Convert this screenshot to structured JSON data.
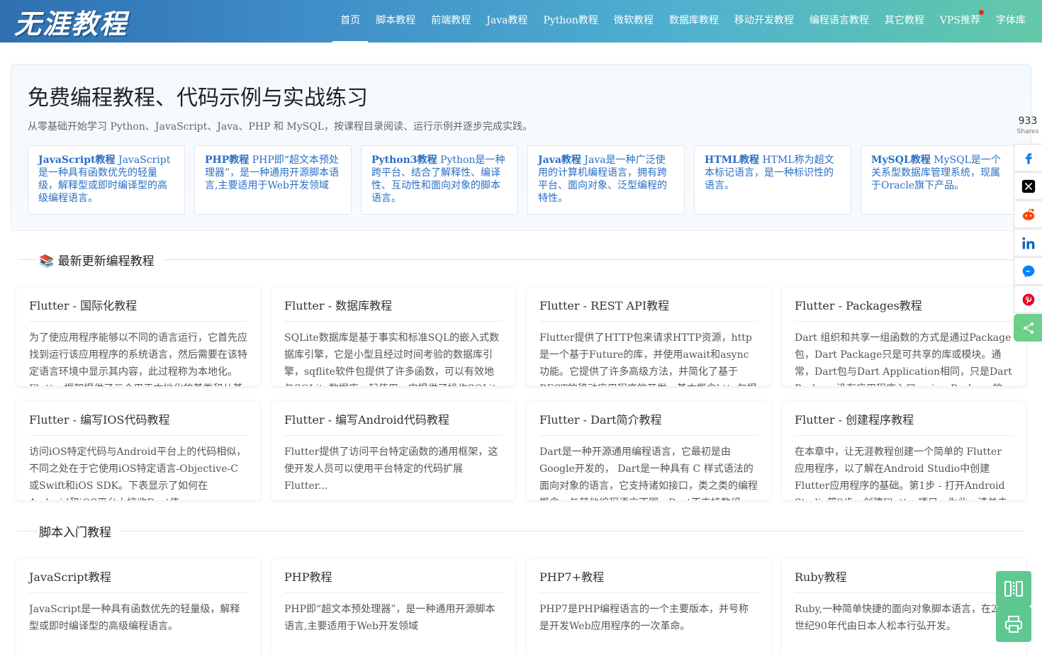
{
  "header": {
    "logo_text": "无涯教程",
    "nav": [
      {
        "label": "首页",
        "active": true
      },
      {
        "label": "脚本教程"
      },
      {
        "label": "前端教程"
      },
      {
        "label": "Java教程"
      },
      {
        "label": "Python教程"
      },
      {
        "label": "微软教程"
      },
      {
        "label": "数据库教程"
      },
      {
        "label": "移动开发教程"
      },
      {
        "label": "编程语言教程"
      },
      {
        "label": "其它教程"
      },
      {
        "label": "VPS推荐",
        "badge_dot": true
      },
      {
        "label": "字体库"
      }
    ]
  },
  "hero": {
    "title": "免费编程教程、代码示例与实战练习",
    "subtitle": "从零基础开始学习 Python、JavaScript、Java、PHP 和 MySQL，按课程目录阅读、运行示例并逐步完成实践。",
    "features": [
      {
        "name": "JavaScript教程",
        "desc": "JavaScript是一种具有函数优先的轻量级，解释型或即时编译型的高级编程语言。"
      },
      {
        "name": "PHP教程",
        "desc": "PHP即“超文本预处理器”，是一种通用开源脚本语言,主要适用于Web开发领域"
      },
      {
        "name": "Python3教程",
        "desc": "Python是一种跨平台、结合了解释性、编译性、互动性和面向对象的脚本语言。"
      },
      {
        "name": "Java教程",
        "desc": "Java是一种广泛使用的计算机编程语言，拥有跨平台、面向对象、泛型编程的特性。"
      },
      {
        "name": "HTML教程",
        "desc": "HTML称为超文本标记语言，是一种标识性的语言。"
      },
      {
        "name": "MySQL教程",
        "desc": "MySQL是一个关系型数据库管理系统，现属于Oracle旗下产品。"
      }
    ]
  },
  "sections": [
    {
      "icon": "📚",
      "title": "最新更新编程教程",
      "cards": [
        {
          "title": "Flutter - 国际化教程",
          "body": "为了使应用程序能够以不同的语言运行，它首先应找到运行该应用程序的系统语言，然后需要在该特定语言环境中显示其内容，此过程称为本地化。Flutter框架提供了三个用于本地化的基类和从基类"
        },
        {
          "title": "Flutter - 数据库教程",
          "body": "SQLite数据库是基于事实和标准SQL的嵌入式数据库引擎，它是小型且经过时间考验的数据库引擎，sqflite软件包提供了许多函数，可以有效地与SQLite数据库一起使用，它提供了操作SQLite数据"
        },
        {
          "title": "Flutter - REST API教程",
          "body": "Flutter提供了HTTP包来请求HTTP资源，http是一个基于Future的库，并使用await和async功能。它提供了许多高级方法，并简化了基于REST的移动应用程序的开发。基本概念http包提供了一个高级"
        },
        {
          "title": "Flutter - Packages教程",
          "body": "Dart 组织和共享一组函数的方式是通过Package包，Dart Package只是可共享的库或模块。通常，Dart包与Dart Application相同，只是Dart Package没有应用程序入口main。Package的一般结构(考虑一"
        },
        {
          "title": "Flutter - 编写IOS代码教程",
          "body": "访问iOS特定代码与Android平台上的代码相似，不同之处在于它使用iOS特定语言-Objective-C或Swift和iOS SDK。下表显示了如何在Android和iOS平台上接收Dart值。dartandroidiosnullnull无(嵌套时为"
        },
        {
          "title": "Flutter - 编写Android代码教程",
          "body": "Flutter提供了访问平台特定函数的通用框架，这使开发人员可以使用平台特定的代码扩展 Flutter..."
        },
        {
          "title": "Flutter - Dart简介教程",
          "body": "Dart是一种开源通用编程语言，它最初是由Google开发的， Dart是一种具有 C 样式语法的面向对象的语言，它支持诸如接口，类之类的编程概念，与其他编程语言不同，Dart不支持数组， Dart集合可"
        },
        {
          "title": "Flutter - 创建程序教程",
          "body": "在本章中，让无涯教程创建一个简单的 Flutter 应用程序，以了解在Android Studio中创建Flutter应用程序的基础。第1步 - 打开Android Studio第2步 - 创建Flutter项目。为此，请单击File→New→New"
        }
      ]
    },
    {
      "icon": "",
      "title": "脚本入门教程",
      "cards": [
        {
          "title": "JavaScript教程",
          "body": "JavaScript是一种具有函数优先的轻量级，解释型或即时编译型的高级编程语言。"
        },
        {
          "title": "PHP教程",
          "body": "PHP即“超文本预处理器”，是一种通用开源脚本语言,主要适用于Web开发领域"
        },
        {
          "title": "PHP7+教程",
          "body": "PHP7是PHP编程语言的一个主要版本，并号称是开发Web应用程序的一次革命。"
        },
        {
          "title": "Ruby教程",
          "body": "Ruby,一种简单快捷的面向对象脚本语言，在20世纪90年代由日本人松本行弘开发。"
        }
      ]
    }
  ],
  "share": {
    "count": "933",
    "count_label": "Shares",
    "buttons": [
      "facebook-icon",
      "x-twitter-icon",
      "reddit-icon",
      "linkedin-icon",
      "messenger-icon",
      "pinterest-icon",
      "share-icon"
    ],
    "colors": {
      "facebook": "#1877f2",
      "x": "#000000",
      "reddit": "#ff4500",
      "linkedin": "#0a66c2",
      "messenger": "#0084ff",
      "pinterest": "#e60023",
      "share": "#6dcf8a"
    }
  },
  "tools": [
    "reader-mode-icon",
    "print-icon"
  ],
  "colors": {
    "accent_green": "#5fc891",
    "link_blue": "#2a6fc4"
  }
}
